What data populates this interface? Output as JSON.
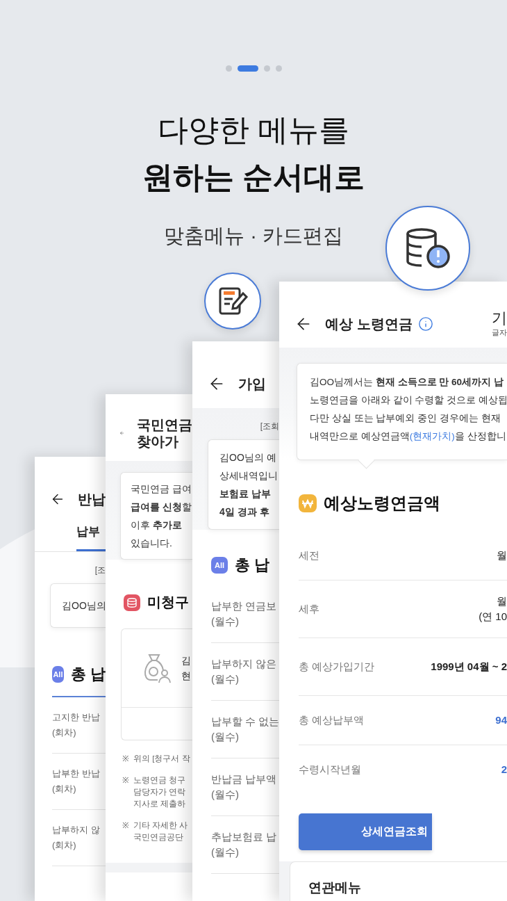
{
  "pager": [
    {
      "selected": false
    },
    {
      "selected": true
    },
    {
      "selected": false
    },
    {
      "selected": false
    }
  ],
  "headline": {
    "line_1": "다양한 메뉴를",
    "line_2": "원하는 순서대로"
  },
  "subtitle": "맞춤메뉴 · 카드편집",
  "screens": [
    {
      "kind": "repayment",
      "title": "반납",
      "tab": {
        "label": "납부",
        "selected": true
      },
      "query_note": "[조",
      "info_lines": [
        "김OO님의"
      ],
      "section": {
        "badge": "All",
        "title": "총 납"
      },
      "rows": [
        {
          "label": "고지한 반납",
          "unit": "(회차)"
        },
        {
          "label": "납부한 반납",
          "unit": "(회차)"
        },
        {
          "label": "납부하지 않",
          "unit": "(회차)"
        }
      ]
    },
    {
      "kind": "unclaimed",
      "title_lines": [
        "국민연금",
        "찾아가"
      ],
      "info_lines": [
        "국민연금 급여",
        "**급여를 신청**할",
        "이후 **추가로**",
        "있습니다."
      ],
      "section": {
        "title": "미청구"
      },
      "claim_lines": [
        "김",
        "현"
      ],
      "notes": [
        {
          "mark": "※",
          "lines": [
            "위의 [청구서 작"
          ]
        },
        {
          "mark": "※",
          "lines": [
            "노령연금 청구",
            "담당자가 연락",
            "지사로 제출하"
          ]
        },
        {
          "mark": "※",
          "lines": [
            "기타 자세한 사",
            "국민연금공단"
          ]
        }
      ]
    },
    {
      "kind": "subscription",
      "title": "가입",
      "query_note": "[조회",
      "info_lines": [
        "김OO님의 예",
        "상세내역입니",
        "**보험료 납부**",
        "**4일 경과 후**"
      ],
      "section": {
        "badge": "All",
        "title": "총 납"
      },
      "rows": [
        {
          "label": "납부한 연금보",
          "unit": "(월수)"
        },
        {
          "label": "납부하지 않은",
          "unit": "(월수)"
        },
        {
          "label": "납부할 수 없는",
          "unit": "(월수)"
        },
        {
          "label": "반납금 납부액",
          "unit": "(월수)"
        },
        {
          "label": "추납보험료 납",
          "unit": "(월수)"
        }
      ]
    },
    {
      "kind": "pension",
      "title": "예상 노령연금",
      "font_size": {
        "label": "기",
        "caption": "글자"
      },
      "info_lines": [
        {
          "text": "김OO님께서는 **현재 소득으로 만 60세까지 납**"
        },
        {
          "text": "노령연금을 아래와 같이 수령할 것으로 예상됩"
        },
        {
          "text": "다만 상실 또는 납부예외 중인 경우에는 현재"
        },
        {
          "text": "내역만으로 예상연금액",
          "link": "(현재가치)",
          "after": "을 산정합니"
        }
      ],
      "section": {
        "title": "예상노령연금액"
      },
      "rows": [
        {
          "label": "세전",
          "values": [
            "월"
          ],
          "kind": "plain"
        },
        {
          "label": "세후",
          "values": [
            "월",
            "(연 10"
          ],
          "kind": "plain"
        },
        {
          "label": "총 예상가입기간",
          "values": [
            "1999년 04월 ~ 2"
          ],
          "kind": "strong"
        },
        {
          "label": "총 예상납부액",
          "values": [
            "94"
          ],
          "kind": "accent"
        },
        {
          "label": "수령시작년월",
          "values": [
            "2"
          ],
          "kind": "accent"
        }
      ],
      "button": "상세연금조회",
      "related": {
        "title": "연관메뉴"
      }
    }
  ]
}
